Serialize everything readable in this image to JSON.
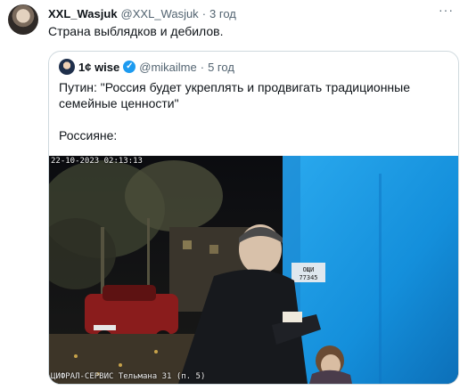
{
  "tweet": {
    "author_name": "XXL_Wasjuk",
    "handle": "@XXL_Wasjuk",
    "separator": "·",
    "time": "3 год",
    "more_icon": "more-icon",
    "text": "Страна выблядков и дебилов."
  },
  "quote": {
    "author_name": "1¢ wise",
    "verified_icon": "verified-badge-icon",
    "handle": "@mikailme",
    "separator": "·",
    "time": "5 год",
    "text_line1": "Путин: \"Россия будет укреплять и продвигать традиционные семейные ценности\"",
    "text_line2": "Россияне:",
    "media": {
      "osd_timestamp": "22-10-2023 02:13:13",
      "osd_camera": "ЦИФРАЛ-СЕРВИС Тельмана 31   (п. 5)",
      "sign_text_1": "ОЩИ",
      "sign_text_2": "77345"
    }
  },
  "colors": {
    "text": "#0f1419",
    "muted": "#536471",
    "border": "#cfd9de",
    "verified": "#1d9bf0"
  }
}
